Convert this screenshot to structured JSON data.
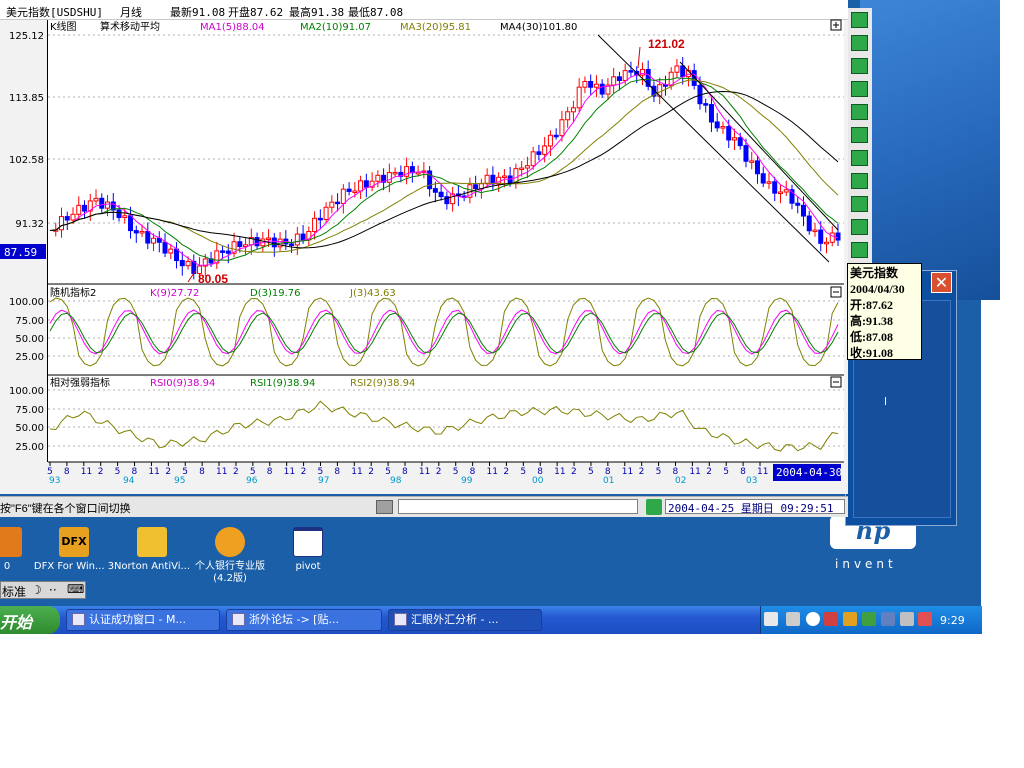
{
  "chart_window": {
    "title": {
      "symbol": "美元指数[USDSHU]",
      "period": "月线",
      "latest": "最新91.08",
      "open": "开盘87.62",
      "high": "最高91.38",
      "low": "最低87.08"
    },
    "price_panel": {
      "name": "K线图",
      "overlay": "算术移动平均",
      "ma1": "MA1(5)88.04",
      "ma2": "MA2(10)91.07",
      "ma3": "MA3(20)95.81",
      "ma4": "MA4(30)101.80",
      "y_ticks": [
        "125.12",
        "113.85",
        "102.58",
        "91.32"
      ],
      "current_price": "87.59",
      "high_marker": "121.02",
      "low_marker": "80.05"
    },
    "kd_panel": {
      "name": "随机指标2",
      "k": "K(9)27.72",
      "d": "D(3)19.76",
      "j": "J(3)43.63",
      "y_ticks": [
        "100.00",
        "75.00",
        "50.00",
        "25.00"
      ]
    },
    "rsi_panel": {
      "name": "相对强弱指标",
      "rsi0": "RSI0(9)38.94",
      "rsi1": "RSI1(9)38.94",
      "rsi2": "RSI2(9)38.94",
      "y_ticks": [
        "100.00",
        "75.00",
        "50.00",
        "25.00"
      ]
    },
    "x_axis": {
      "month_ticks": [
        "5",
        "8",
        "11",
        "2",
        "5",
        "8",
        "11",
        "2",
        "5",
        "8",
        "11",
        "2",
        "5",
        "8",
        "11",
        "2",
        "5",
        "8",
        "11",
        "2",
        "5",
        "8",
        "11",
        "2",
        "5",
        "8",
        "11",
        "2",
        "5",
        "8",
        "11",
        "2",
        "5",
        "8",
        "11",
        "2",
        "5",
        "8",
        "11",
        "2",
        "5",
        "8",
        "11"
      ],
      "year_labels": [
        "93",
        "94",
        "95",
        "96",
        "97",
        "98",
        "99",
        "00",
        "01",
        "02",
        "03"
      ],
      "current_date": "2004-04-30"
    },
    "info_popup": {
      "title": "美元指数",
      "date": "2004/04/30",
      "open": "开:87.62",
      "high": "高:91.38",
      "low": "低:87.08",
      "close": "收:91.08"
    },
    "status_bar": {
      "hint": "按\"F6\"键在各个窗口间切换",
      "datetime": "2004-04-25  星期日  09:29:51"
    },
    "toolbar_icons": [
      "pointer-icon",
      "a-text-icon",
      "trendline-icon",
      "channel-icon",
      "parallel-icon",
      "rect-icon",
      "ray-icon",
      "fibonacci-icon",
      "gann-icon",
      "cycle-icon",
      "grid-icon"
    ]
  },
  "dialog": {
    "close_glyph": "✕",
    "edge_text": "l"
  },
  "desktop": {
    "icons": [
      {
        "label": "0",
        "color": "#e07a1a"
      },
      {
        "label": "DFX For Win... 3",
        "color": "#e8a020",
        "badge": "DFX"
      },
      {
        "label": "Norton AntiVi...",
        "color": "#f0c030"
      },
      {
        "label": "个人银行专业版(4.2版)",
        "color": "#f0a020"
      },
      {
        "label": "pivot",
        "color": "#ffffff"
      }
    ],
    "ime_bar": {
      "mode": "标准",
      "moon": "☽",
      "dots": "··",
      "keyboard": "⌨"
    },
    "brand": {
      "mark": "hp",
      "word": "invent"
    }
  },
  "taskbar": {
    "start_label": "开始",
    "tasks": [
      {
        "label": "认证成功窗口 - M..."
      },
      {
        "label": "浙外论坛 -> [贴..."
      },
      {
        "label": "汇眼外汇分析 - ..."
      }
    ],
    "clock": "9:29"
  },
  "colors": {
    "up_candle": "#ff0000",
    "down_candle": "#0000ff",
    "ma1": "#ff00ff",
    "ma2": "#008000",
    "ma3": "#808000",
    "ma4": "#000000",
    "highlight_blue": "#0000cc",
    "axis_year": "#0099cc"
  }
}
